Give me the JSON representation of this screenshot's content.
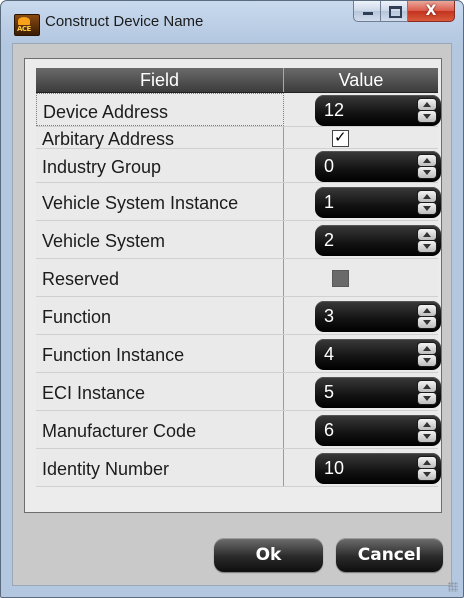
{
  "window": {
    "title": "Construct Device Name",
    "app_icon": "ace-app-icon",
    "app_icon_text": "ACE",
    "controls": {
      "minimize": "minimize-icon",
      "maximize": "maximize-icon",
      "close": "X"
    }
  },
  "grid": {
    "columns": {
      "field": "Field",
      "value": "Value"
    },
    "rows": [
      {
        "field": "Device Address",
        "type": "spinner",
        "value": "12"
      },
      {
        "field": "Arbitary Address",
        "type": "checkbox",
        "checked": true,
        "check_glyph": "✓"
      },
      {
        "field": "Industry Group",
        "type": "spinner",
        "value": "0"
      },
      {
        "field": "Vehicle System Instance",
        "type": "spinner",
        "value": "1"
      },
      {
        "field": "Vehicle System",
        "type": "spinner",
        "value": "2"
      },
      {
        "field": "Reserved",
        "type": "checkbox-disabled",
        "checked": false
      },
      {
        "field": "Function",
        "type": "spinner",
        "value": "3"
      },
      {
        "field": "Function Instance",
        "type": "spinner",
        "value": "4"
      },
      {
        "field": "ECI Instance",
        "type": "spinner",
        "value": "5"
      },
      {
        "field": "Manufacturer Code",
        "type": "spinner",
        "value": "6"
      },
      {
        "field": "Identity Number",
        "type": "spinner",
        "value": "10"
      }
    ]
  },
  "buttons": {
    "ok": "Ok",
    "cancel": "Cancel"
  },
  "colors": {
    "window_frame": "#b9cce4",
    "header_bg": "#4a4a4a",
    "spinner_bg": "#121212",
    "button_bg": "#2a2a2a",
    "close_button": "#c3331f"
  }
}
